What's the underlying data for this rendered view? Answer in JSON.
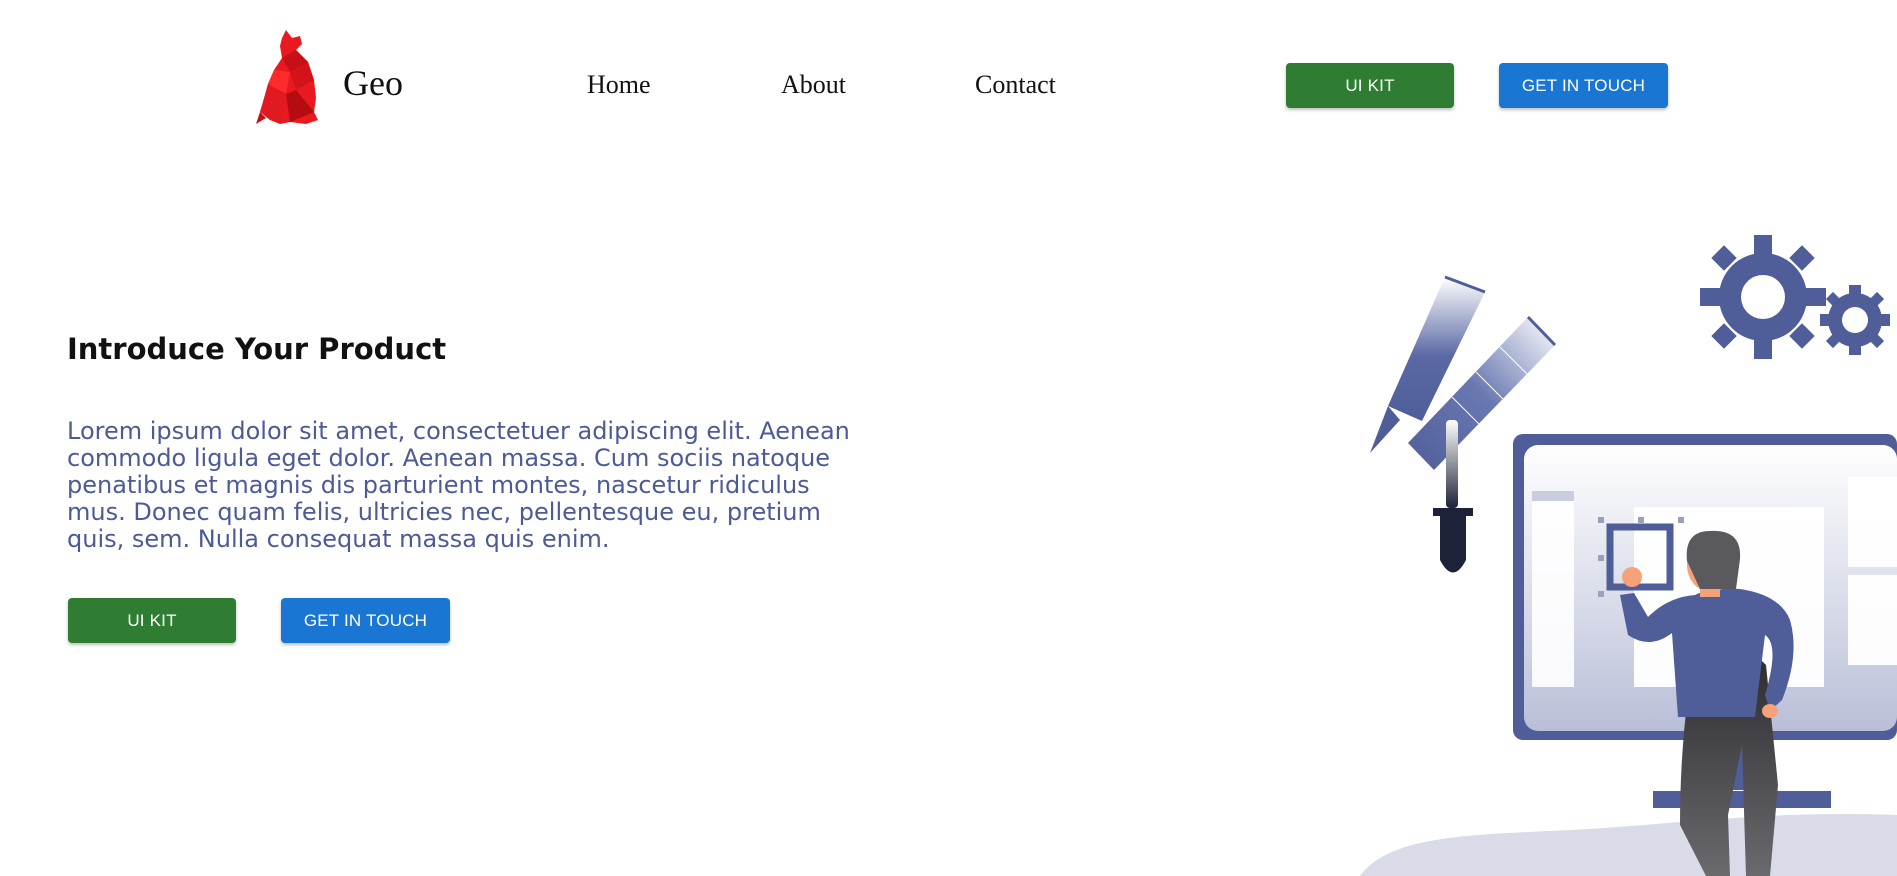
{
  "brand": {
    "name": "Geo",
    "logo_icon": "red-cat-logo-icon"
  },
  "nav": {
    "links": [
      "Home",
      "About",
      "Contact"
    ],
    "ui_kit_label": "UI KIT",
    "contact_label": "GET IN TOUCH"
  },
  "hero": {
    "title": "Introduce Your Product",
    "body": "Lorem ipsum dolor sit amet, consectetuer adipiscing elit. Aenean commodo ligula eget dolor. Aenean massa. Cum sociis natoque penatibus et magnis dis parturient montes, nascetur ridiculus mus. Donec quam felis, ultricies nec, pellentesque eu, pretium quis, sem. Nulla consequat massa quis enim.",
    "ui_kit_label": "UI KIT",
    "contact_label": "GET IN TOUCH",
    "illustration_icon": "designer-at-monitor-illustration"
  },
  "colors": {
    "green_button": "#2e7d32",
    "blue_button": "#1976d2",
    "body_text": "#4c5a96",
    "illustration": "#4f5d99"
  }
}
